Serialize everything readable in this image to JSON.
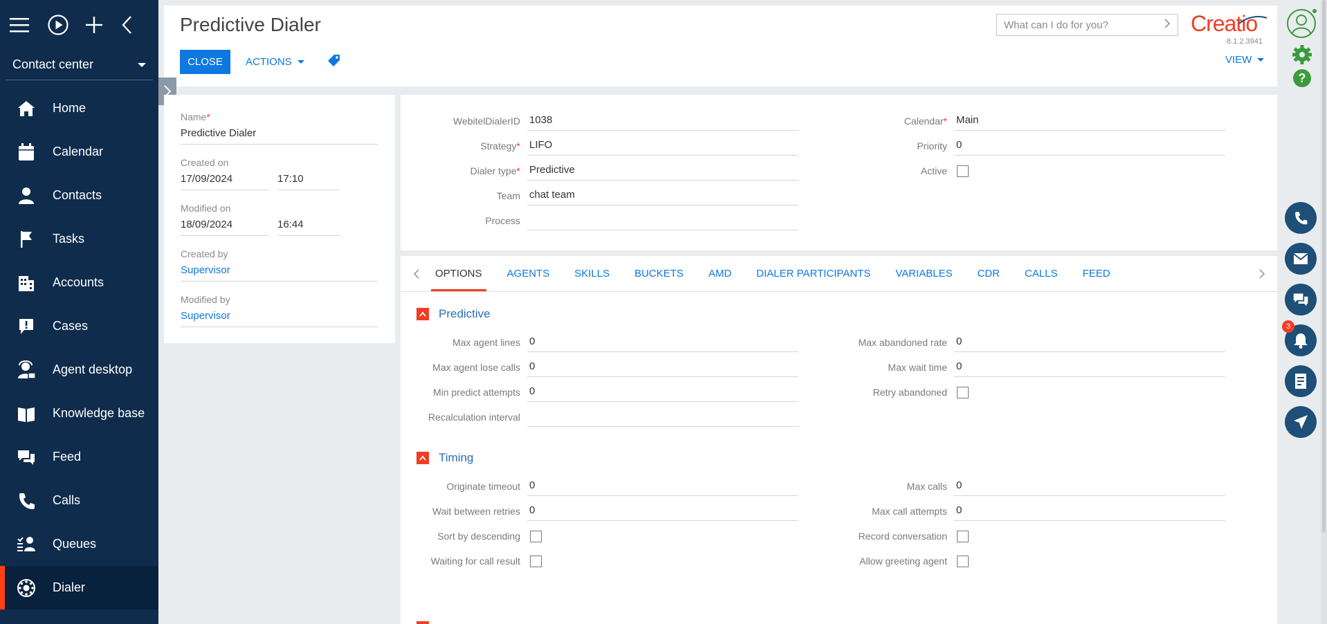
{
  "sidebar": {
    "workspace": "Contact center",
    "items": [
      {
        "label": "Home",
        "icon": "home-icon"
      },
      {
        "label": "Calendar",
        "icon": "calendar-icon"
      },
      {
        "label": "Contacts",
        "icon": "contact-icon"
      },
      {
        "label": "Tasks",
        "icon": "flag-icon"
      },
      {
        "label": "Accounts",
        "icon": "building-icon"
      },
      {
        "label": "Cases",
        "icon": "alert-bubble-icon"
      },
      {
        "label": "Agent desktop",
        "icon": "agent-icon"
      },
      {
        "label": "Knowledge base",
        "icon": "book-icon"
      },
      {
        "label": "Feed",
        "icon": "chat-icon"
      },
      {
        "label": "Calls",
        "icon": "phone-icon"
      },
      {
        "label": "Queues",
        "icon": "queue-icon"
      },
      {
        "label": "Dialer",
        "icon": "dialer-icon",
        "active": true
      }
    ]
  },
  "header": {
    "title": "Predictive Dialer",
    "close_label": "CLOSE",
    "actions_label": "ACTIONS",
    "search_placeholder": "What can I do for you?",
    "logo": "Creatio",
    "version": "8.1.2.3941",
    "view_label": "VIEW"
  },
  "info": {
    "name_label": "Name",
    "name_value": "Predictive Dialer",
    "created_on_label": "Created on",
    "created_date": "17/09/2024",
    "created_time": "17:10",
    "modified_on_label": "Modified on",
    "modified_date": "18/09/2024",
    "modified_time": "16:44",
    "created_by_label": "Created by",
    "created_by": "Supervisor",
    "modified_by_label": "Modified by",
    "modified_by": "Supervisor"
  },
  "form": {
    "webitel_label": "WebitelDialerID",
    "webitel_value": "1038",
    "strategy_label": "Strategy",
    "strategy_value": "LIFO",
    "dialer_type_label": "Dialer type",
    "dialer_type_value": "Predictive",
    "team_label": "Team",
    "team_value": "chat  team",
    "process_label": "Process",
    "process_value": "",
    "calendar_label": "Calendar",
    "calendar_value": "Main",
    "priority_label": "Priority",
    "priority_value": "0",
    "active_label": "Active"
  },
  "tabs": [
    "OPTIONS",
    "AGENTS",
    "SKILLS",
    "BUCKETS",
    "AMD",
    "DIALER PARTICIPANTS",
    "VARIABLES",
    "CDR",
    "CALLS",
    "FEED"
  ],
  "predictive": {
    "title": "Predictive",
    "max_agent_lines_label": "Max agent lines",
    "max_agent_lines": "0",
    "max_agent_lose_calls_label": "Max agent lose calls",
    "max_agent_lose_calls": "0",
    "min_predict_attempts_label": "Min predict attempts",
    "min_predict_attempts": "0",
    "recalc_interval_label": "Recalculation interval",
    "recalc_interval": "",
    "max_abandoned_rate_label": "Max abandoned rate",
    "max_abandoned_rate": "0",
    "max_wait_time_label": "Max wait time",
    "max_wait_time": "0",
    "retry_abandoned_label": "Retry abandoned"
  },
  "timing": {
    "title": "Timing",
    "originate_timeout_label": "Originate timeout",
    "originate_timeout": "0",
    "wait_between_retries_label": "Wait between retries",
    "wait_between_retries": "0",
    "sort_by_descending_label": "Sort by descending",
    "waiting_for_call_result_label": "Waiting for call result",
    "max_calls_label": "Max calls",
    "max_calls": "0",
    "max_call_attempts_label": "Max call attempts",
    "max_call_attempts": "0",
    "record_conversation_label": "Record conversation",
    "allow_greeting_agent_label": "Allow greeting agent"
  },
  "rail": {
    "notifications_count": "3"
  },
  "colors": {
    "sidebar_bg": "#0f2c4c",
    "accent": "#ef3e23",
    "link": "#0d78e0",
    "rail_button": "#1d4f78",
    "settings_green": "#3a9b3a"
  }
}
